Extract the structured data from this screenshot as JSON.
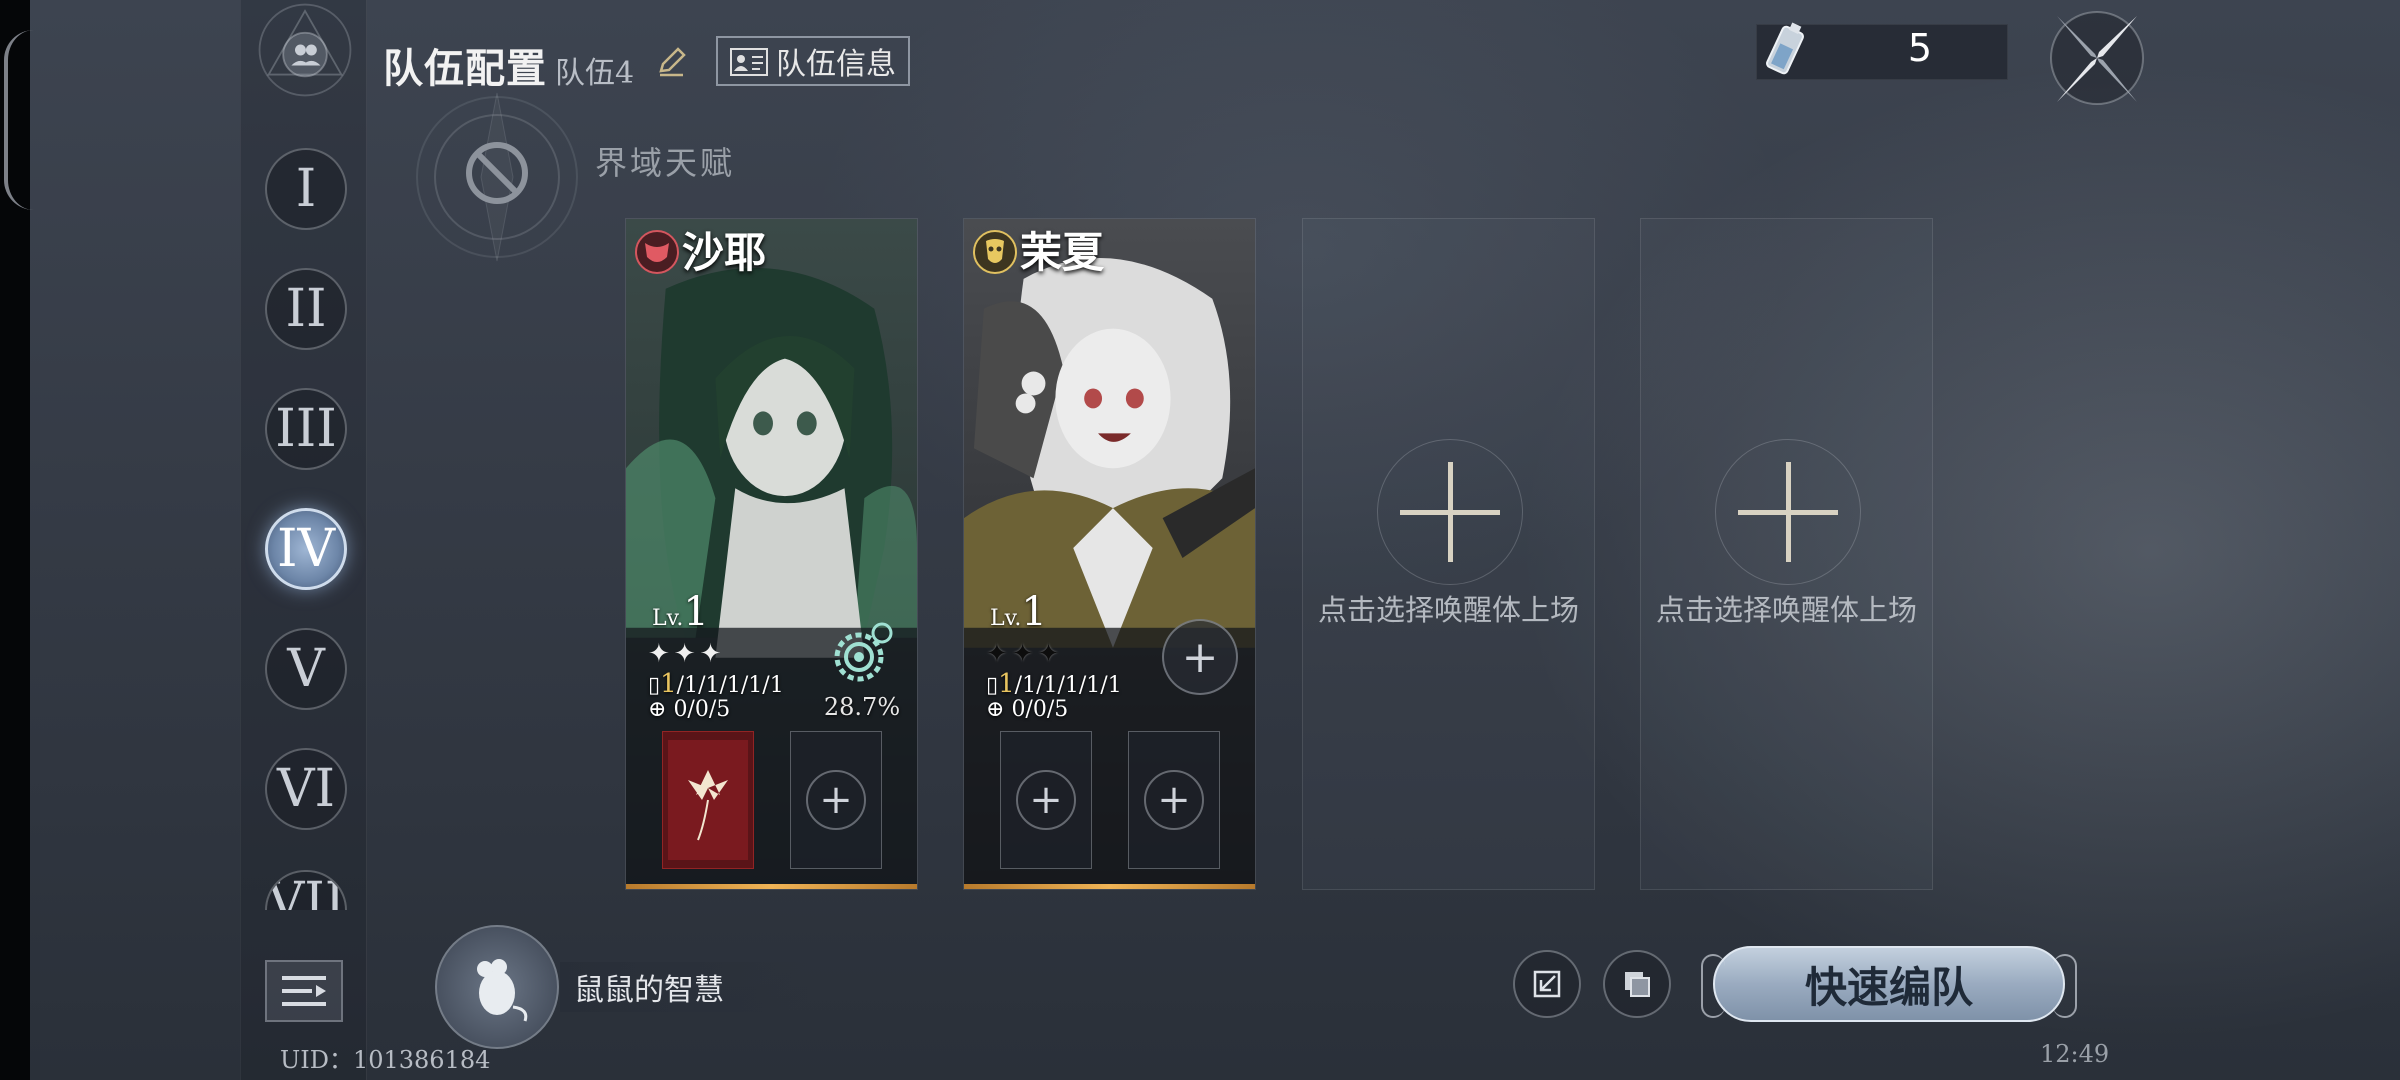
{
  "header": {
    "title": "队伍配置",
    "team_name": "队伍4",
    "team_info_button": "队伍信息"
  },
  "talent": {
    "label": "界域天赋"
  },
  "team_tabs": [
    "I",
    "II",
    "III",
    "IV",
    "V",
    "VI",
    "VII"
  ],
  "active_tab": "IV",
  "energy": {
    "value": "5"
  },
  "cards": [
    {
      "name": "沙耶",
      "lv_text": "Lv.",
      "level": "1",
      "stars": "✦✦✦",
      "stat_highlight": "1",
      "stat_rest": "/1/1/1/1/1",
      "stat2": "0/0/5",
      "gear_percent": "28.7%"
    },
    {
      "name": "茉夏",
      "lv_text": "Lv.",
      "level": "1",
      "stars": "✦✦✦",
      "stat_highlight": "1",
      "stat_rest": "/1/1/1/1/1",
      "stat2": "0/0/5"
    }
  ],
  "empty_slot_text": "点击选择唤醒体上场",
  "wisdom": {
    "label": "鼠鼠的智慧"
  },
  "quick_team_button": "快速编队",
  "uid": "UID：101386184",
  "clock": "12:49",
  "colors": {
    "accent_gold": "#f0b456",
    "active_tab": "#6d86a8"
  }
}
